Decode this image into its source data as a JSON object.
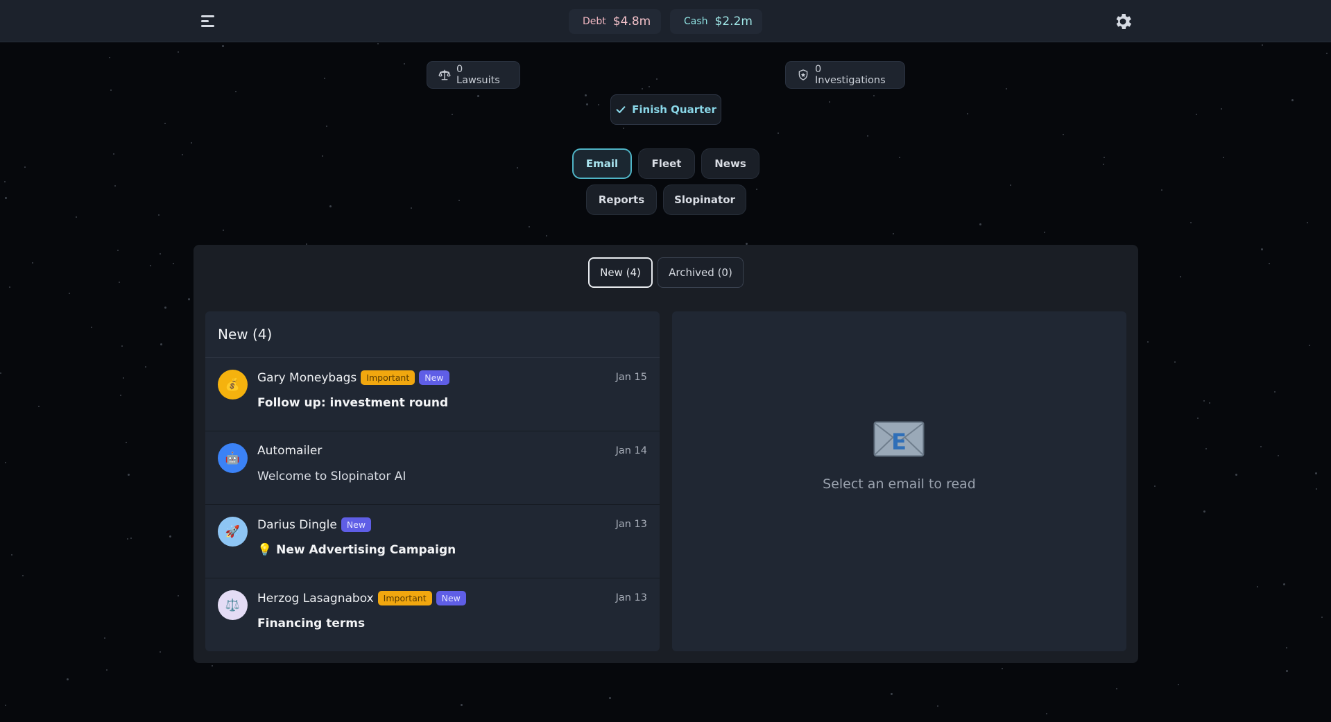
{
  "header": {
    "debt_label": "Debt",
    "debt_value": "$4.8m",
    "cash_label": "Cash",
    "cash_value": "$2.2m",
    "menu_icon": "hamburger-menu-icon",
    "settings_icon": "gear-icon"
  },
  "status": {
    "lawsuits": "0 Lawsuits",
    "investigations": "0 Investigations",
    "finish_quarter": "Finish Quarter"
  },
  "nav": {
    "email": "Email",
    "fleet": "Fleet",
    "news": "News",
    "reports": "Reports",
    "slopinator": "Slopinator",
    "active": "Email"
  },
  "mail": {
    "tabs": {
      "new": "New (4)",
      "archived": "Archived (0)"
    },
    "list_title": "New (4)",
    "emails": [
      {
        "sender": "Gary Moneybags",
        "badges": [
          "Important",
          "New"
        ],
        "date": "Jan 15",
        "subject": "Follow up: investment round",
        "avatar": "💰",
        "avatar_color": "#f5b20e"
      },
      {
        "sender": "Automailer",
        "badges": [],
        "date": "Jan 14",
        "subject": "Welcome to Slopinator AI",
        "avatar": "🤖",
        "avatar_color": "#3b82f6"
      },
      {
        "sender": "Darius Dingle",
        "badges": [
          "New"
        ],
        "date": "Jan 13",
        "subject": "💡 New Advertising Campaign",
        "avatar": "🚀",
        "avatar_color": "#8ec5f4"
      },
      {
        "sender": "Herzog Lasagnabox",
        "badges": [
          "Important",
          "New"
        ],
        "date": "Jan 13",
        "subject": "Financing terms",
        "avatar": "⚖️",
        "avatar_color": "#e4dcf5"
      }
    ],
    "reader_placeholder": "Select an email to read",
    "reader_icon": "envelope-e-icon"
  },
  "colors": {
    "accent": "#4fb4c6",
    "important_badge": "#f1a70f",
    "new_badge": "#5f5ee6"
  }
}
